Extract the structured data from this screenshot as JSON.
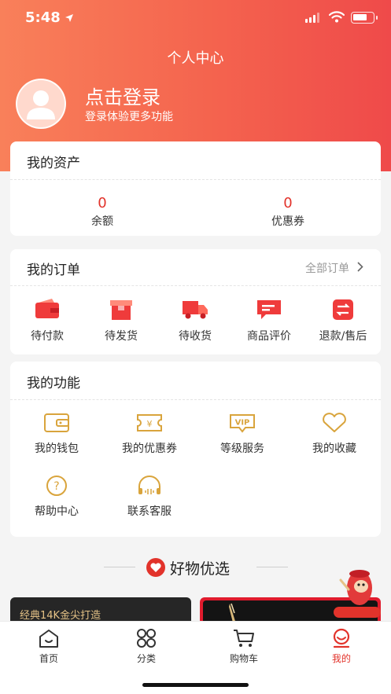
{
  "status_bar": {
    "time": "5:48"
  },
  "header": {
    "title": "个人中心",
    "login_title": "点击登录",
    "login_subtitle": "登录体验更多功能"
  },
  "assets": {
    "title": "我的资产",
    "items": [
      {
        "value": "0",
        "label": "余额"
      },
      {
        "value": "0",
        "label": "优惠券"
      }
    ]
  },
  "orders": {
    "title": "我的订单",
    "all_link": "全部订单",
    "items": [
      {
        "label": "待付款",
        "icon": "wallet-icon"
      },
      {
        "label": "待发货",
        "icon": "package-icon"
      },
      {
        "label": "待收货",
        "icon": "truck-icon"
      },
      {
        "label": "商品评价",
        "icon": "comment-icon"
      },
      {
        "label": "退款/售后",
        "icon": "refund-icon"
      }
    ]
  },
  "functions": {
    "title": "我的功能",
    "items": [
      {
        "label": "我的钱包",
        "icon": "wallet-outline-icon"
      },
      {
        "label": "我的优惠券",
        "icon": "coupon-icon"
      },
      {
        "label": "等级服务",
        "icon": "vip-icon",
        "badge": "VIP"
      },
      {
        "label": "我的收藏",
        "icon": "heart-outline-icon"
      },
      {
        "label": "帮助中心",
        "icon": "help-icon"
      },
      {
        "label": "联系客服",
        "icon": "headset-icon"
      }
    ]
  },
  "section": {
    "title": "好物优选"
  },
  "promo": {
    "left_text": "经典14K金尖打造"
  },
  "tabs": [
    {
      "label": "首页",
      "icon": "home-icon",
      "active": false
    },
    {
      "label": "分类",
      "icon": "category-icon",
      "active": false
    },
    {
      "label": "购物车",
      "icon": "cart-icon",
      "active": false
    },
    {
      "label": "我的",
      "icon": "profile-icon",
      "active": true
    }
  ],
  "colors": {
    "accent": "#e2332b",
    "hero_start": "#f9805a",
    "hero_end": "#ef4a4a",
    "function_icon": "#d9a43c"
  }
}
